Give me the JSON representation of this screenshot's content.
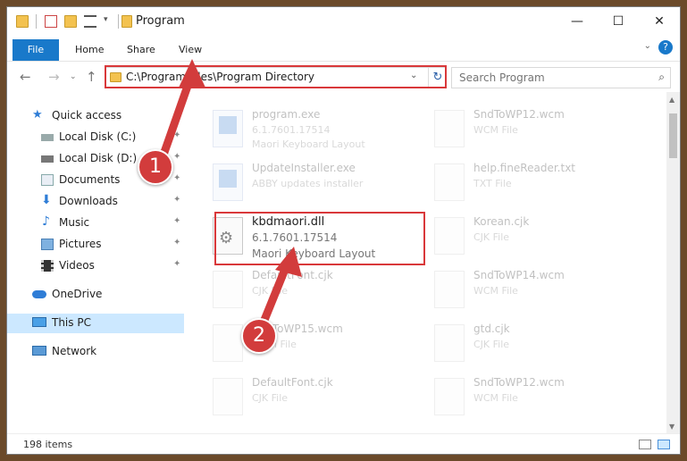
{
  "window": {
    "title": "Program"
  },
  "ribbon": {
    "tabs": [
      "File",
      "Home",
      "Share",
      "View"
    ]
  },
  "address": {
    "path": "C:\\Program Files\\Program Directory"
  },
  "search": {
    "placeholder": "Search Program"
  },
  "nav": {
    "items": [
      {
        "label": "Quick access",
        "icon": "star-icon"
      },
      {
        "label": "Local Disk (C:)",
        "icon": "drive-icon"
      },
      {
        "label": "Local Disk (D:)",
        "icon": "drive-icon"
      },
      {
        "label": "Documents",
        "icon": "documents-icon"
      },
      {
        "label": "Downloads",
        "icon": "download-arrow-icon"
      },
      {
        "label": "Music",
        "icon": "music-note-icon"
      },
      {
        "label": "Pictures",
        "icon": "pictures-icon"
      },
      {
        "label": "Videos",
        "icon": "film-icon"
      },
      {
        "label": "OneDrive",
        "icon": "cloud-icon"
      },
      {
        "label": "This PC",
        "icon": "monitor-icon"
      },
      {
        "label": "Network",
        "icon": "network-icon"
      }
    ]
  },
  "files": [
    {
      "name": "program.exe",
      "line2": "6.1.7601.17514",
      "line3": "Maori Keyboard Layout"
    },
    {
      "name": "SndToWP12.wcm",
      "line2": "WCM File",
      "line3": ""
    },
    {
      "name": "UpdateInstaller.exe",
      "line2": "ABBY updates installer",
      "line3": ""
    },
    {
      "name": "help.fineReader.txt",
      "line2": "TXT File",
      "line3": ""
    },
    {
      "name": "kbdmaori.dll",
      "line2": "6.1.7601.17514",
      "line3": "Maori Keyboard Layout"
    },
    {
      "name": "Korean.cjk",
      "line2": "CJK File",
      "line3": ""
    },
    {
      "name": "DefaultFont.cjk",
      "line2": "CJK File",
      "line3": ""
    },
    {
      "name": "SndToWP14.wcm",
      "line2": "WCM File",
      "line3": ""
    },
    {
      "name": "SndToWP15.wcm",
      "line2": "WCM File",
      "line3": ""
    },
    {
      "name": "gtd.cjk",
      "line2": "CJK File",
      "line3": ""
    },
    {
      "name": "DefaultFont.cjk",
      "line2": "CJK File",
      "line3": ""
    },
    {
      "name": "SndToWP12.wcm",
      "line2": "WCM File",
      "line3": ""
    }
  ],
  "status": {
    "items_count": "198 items"
  },
  "callouts": [
    "1",
    "2"
  ],
  "colors": {
    "accent": "#1979ca",
    "highlight": "#d9383a",
    "selected": "#cce8ff"
  }
}
